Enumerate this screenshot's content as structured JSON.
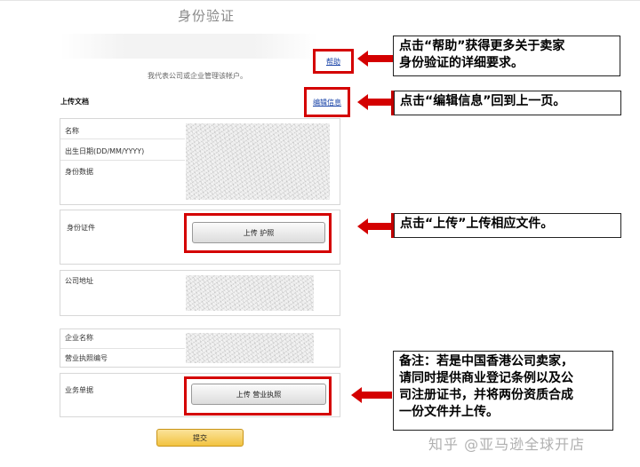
{
  "page": {
    "title": "身份验证",
    "subtitle": "我代表公司或企业管理该帐户。"
  },
  "links": {
    "help": "帮助",
    "edit": "编辑信息"
  },
  "sections": {
    "upload_docs": "上传文档"
  },
  "fields": {
    "name": "名称",
    "dob": "出生日期(DD/MM/YYYY)",
    "id_data": "身份数据",
    "id_document": "身份证件",
    "company_address": "公司地址",
    "company_name": "企业名称",
    "license_number": "营业执照编号",
    "business_docs": "业务单据"
  },
  "buttons": {
    "upload_passport": "上传 护照",
    "upload_license": "上传 营业执照",
    "submit": "提交"
  },
  "callouts": {
    "help_line1": "点击“帮助”获得更多关于卖家",
    "help_line2": "身份验证的详细要求。",
    "edit": "点击“编辑信息”回到上一页。",
    "upload": "点击“上传”上传相应文件。",
    "note_line1": "备注：若是中国香港公司卖家，",
    "note_line2_a": "请同时提供商业登记条例",
    "note_line2_b": "以及",
    "note_line2_c": "公",
    "note_line3": "司注册证书，并将两份资质合成",
    "note_line4": "一份文件并上传。"
  },
  "watermark": "知乎 @亚马逊全球开店",
  "colors": {
    "highlight": "#d40000",
    "link": "#1a44a8",
    "submit": "#f2c341"
  }
}
